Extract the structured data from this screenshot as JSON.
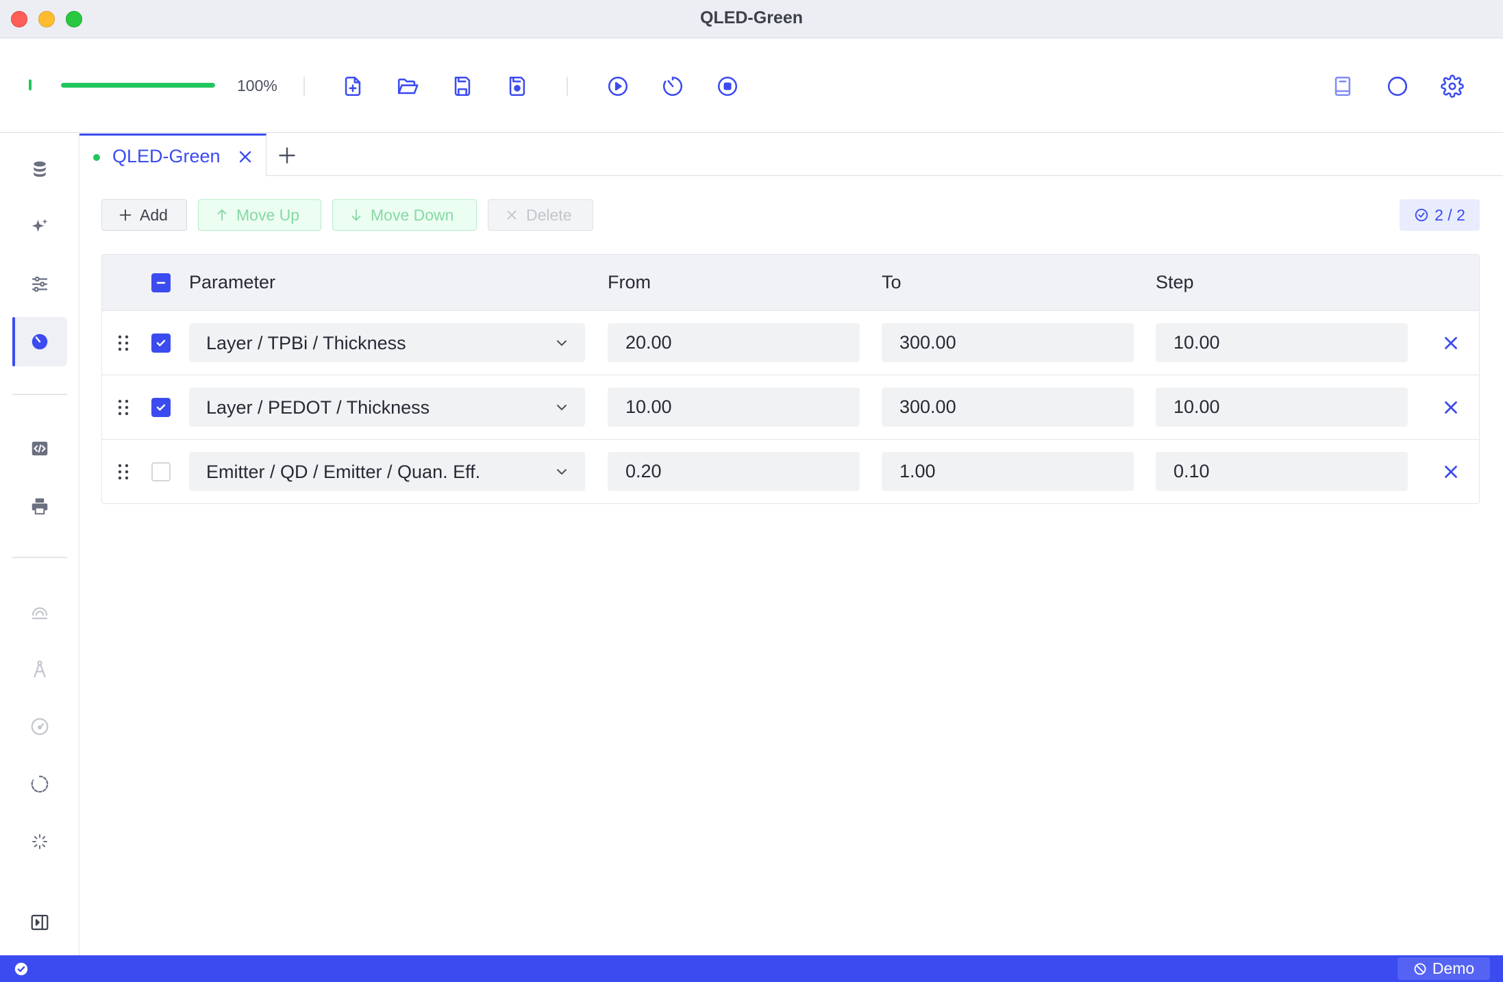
{
  "window": {
    "title": "QLED-Green"
  },
  "toolbar": {
    "progress": 1.0,
    "progress_text": "100%",
    "buttons": [
      "new-file-icon",
      "open-folder-icon",
      "save-icon",
      "save-as-icon",
      "run-icon",
      "timer-icon",
      "stop-icon",
      "book-icon",
      "theme-icon",
      "gear-icon"
    ]
  },
  "sidebar": {
    "items": [
      "database-icon",
      "sparkles-icon",
      "sliders-icon",
      "sweep-icon",
      "code-icon",
      "printer-icon",
      "rainbow-icon",
      "compass-icon",
      "gauge-icon",
      "loader-icon",
      "spinner-icon",
      "panel-toggle-icon"
    ],
    "active": "sweep-icon"
  },
  "tabs": [
    {
      "label": "QLED-Green",
      "status": "green"
    }
  ],
  "actions": {
    "add": "Add",
    "move_up": "Move Up",
    "move_down": "Move Down",
    "delete": "Delete"
  },
  "counter": "2 / 2",
  "table": {
    "headers": {
      "parameter": "Parameter",
      "from": "From",
      "to": "To",
      "step": "Step"
    },
    "rows": [
      {
        "checked": true,
        "parameter": "Layer / TPBi / Thickness",
        "from": "20.00",
        "to": "300.00",
        "step": "10.00"
      },
      {
        "checked": true,
        "parameter": "Layer / PEDOT / Thickness",
        "from": "10.00",
        "to": "300.00",
        "step": "10.00"
      },
      {
        "checked": false,
        "parameter": "Emitter / QD / Emitter / Quan. Eff.",
        "from": "0.20",
        "to": "1.00",
        "step": "0.10"
      }
    ]
  },
  "statusbar": {
    "mode": "Demo"
  },
  "colors": {
    "accent": "#3b4bf0",
    "success": "#22c55e",
    "statusbar": "#3b4bf0"
  }
}
